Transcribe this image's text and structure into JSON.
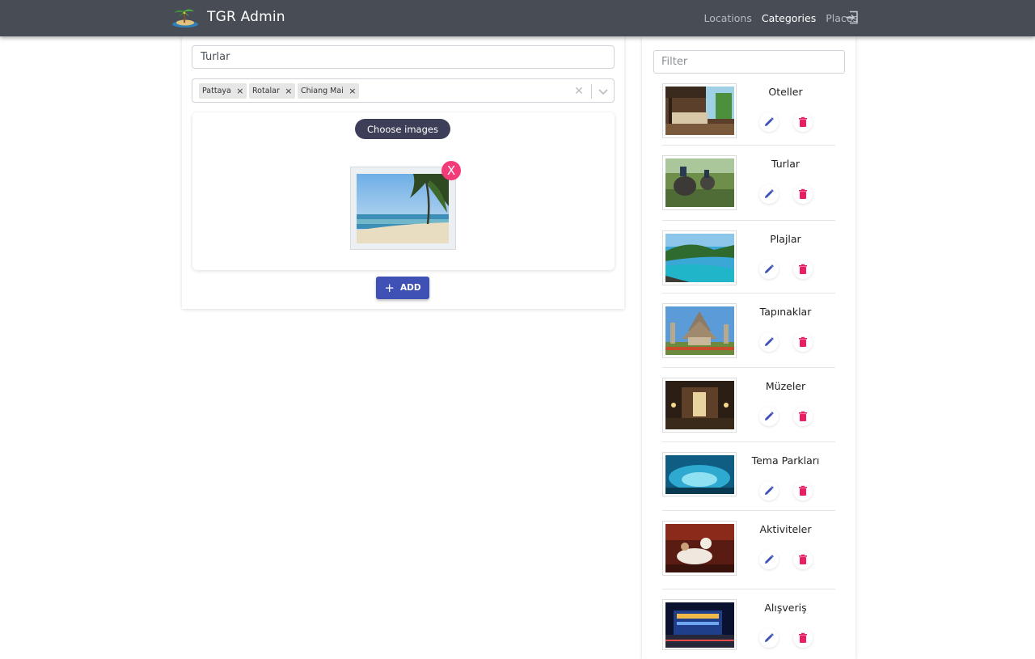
{
  "app": {
    "title": "TGR Admin"
  },
  "nav": {
    "items": [
      {
        "label": "Locations",
        "active": false
      },
      {
        "label": "Categories",
        "active": true
      },
      {
        "label": "Places",
        "active": false
      }
    ],
    "logout_icon": "logout-icon"
  },
  "form": {
    "name_value": "Turlar",
    "selected_locations": [
      "Pattaya",
      "Rotalar",
      "Chiang Mai"
    ],
    "choose_images_label": "Choose images",
    "remove_image_label": "X",
    "add_button_label": "ADD",
    "add_icon": "plus-icon"
  },
  "sidebar": {
    "filter_placeholder": "Filter",
    "categories": [
      {
        "name": "Oteller",
        "thumb": "hotel-room-photo"
      },
      {
        "name": "Turlar",
        "thumb": "elephant-tour-photo"
      },
      {
        "name": "Plajlar",
        "thumb": "beach-bay-photo"
      },
      {
        "name": "Tapınaklar",
        "thumb": "temple-photo"
      },
      {
        "name": "Müzeler",
        "thumb": "museum-hall-photo"
      },
      {
        "name": "Tema Parkları",
        "thumb": "aquarium-tunnel-photo"
      },
      {
        "name": "Aktiviteler",
        "thumb": "massage-photo"
      },
      {
        "name": "Alışveriş",
        "thumb": "mall-night-photo"
      }
    ]
  },
  "colors": {
    "navbar": "#474c55",
    "primary": "#3f51b5",
    "danger": "#e91e63",
    "remove": "#f23b78",
    "choose_button": "#3d3e57"
  }
}
